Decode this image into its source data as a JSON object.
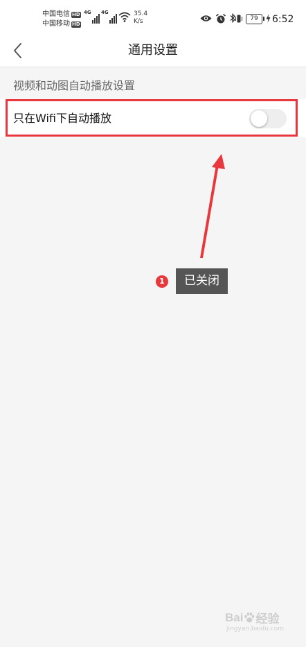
{
  "status_bar": {
    "carrier_1": "中国电信",
    "carrier_2": "中国移动",
    "hd_badge": "HD",
    "signal_1_label": "4G",
    "signal_2_label": "4G",
    "net_speed_value": "35.4",
    "net_speed_unit": "K/s",
    "battery_level": "79",
    "time": "6:52",
    "icons": [
      "signal-icon",
      "wifi-icon",
      "eye-icon",
      "alarm-icon",
      "bluetooth-icon",
      "vibrate-icon",
      "battery-icon",
      "charging-icon"
    ]
  },
  "nav": {
    "title": "通用设置",
    "back_icon": "chevron-left-icon"
  },
  "section": {
    "header": "视频和动图自动播放设置"
  },
  "setting": {
    "label": "只在Wifi下自动播放",
    "toggle_on": false
  },
  "annotation": {
    "step_number": "1",
    "text": "已关闭",
    "color": "#e8383d"
  },
  "watermark": {
    "brand": "Bai百经验",
    "url": "jingyan.baidu.com"
  },
  "colors": {
    "background": "#f5f5f5",
    "annotation_red": "#e8383d",
    "toggle_off_track": "#eeeeee"
  }
}
